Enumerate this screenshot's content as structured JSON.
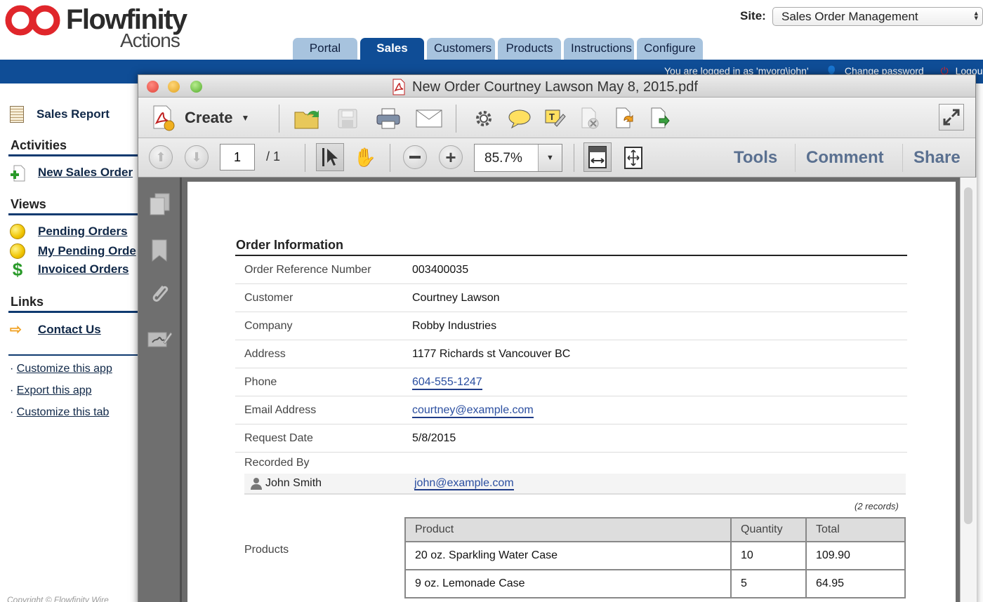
{
  "app": {
    "brand": "Flowfinity",
    "brand_sub": "Actions"
  },
  "site": {
    "label": "Site:",
    "value": "Sales Order Management"
  },
  "tabs": [
    {
      "label": "Portal",
      "active": false
    },
    {
      "label": "Sales",
      "active": true
    },
    {
      "label": "Customers",
      "active": false
    },
    {
      "label": "Products",
      "active": false
    },
    {
      "label": "Instructions",
      "active": false
    },
    {
      "label": "Configure",
      "active": false
    }
  ],
  "userbar": {
    "logged_in": "You are logged in as 'myorg\\john'",
    "change_password": "Change password",
    "logout": "Logou"
  },
  "sidebar": {
    "sales_report": "Sales Report",
    "activities_header": "Activities",
    "new_sales_order": "New Sales Order",
    "views_header": "Views",
    "pending_orders": "Pending Orders",
    "my_pending_orders": "My Pending Orde",
    "invoiced_orders": "Invoiced Orders",
    "links_header": "Links",
    "contact_us": "Contact Us",
    "customize_app": "Customize this app",
    "export_app": "Export this app",
    "customize_tab": "Customize this tab",
    "copyright": "Copyright © Flowfinity Wire"
  },
  "pdf": {
    "title": "New Order Courtney Lawson May 8, 2015.pdf",
    "create_label": "Create",
    "page_current": "1",
    "page_total": "/ 1",
    "zoom": "85.7%",
    "tools": "Tools",
    "comment": "Comment",
    "share": "Share"
  },
  "order": {
    "heading": "Order Information",
    "fields": [
      {
        "label": "Order Reference Number",
        "value": "003400035",
        "link": false
      },
      {
        "label": "Customer",
        "value": "Courtney Lawson",
        "link": false
      },
      {
        "label": "Company",
        "value": "Robby Industries",
        "link": false
      },
      {
        "label": "Address",
        "value": "1177 Richards st Vancouver BC",
        "link": false
      },
      {
        "label": "Phone",
        "value": "604-555-1247",
        "link": true
      },
      {
        "label": "Email Address",
        "value": "courtney@example.com",
        "link": true
      },
      {
        "label": "Request Date",
        "value": "5/8/2015",
        "link": false
      }
    ],
    "recorded_by_label": "Recorded By",
    "recorded_by_name": "John Smith",
    "recorded_by_email": "john@example.com",
    "records_count": "(2 records)",
    "products_label": "Products",
    "products_columns": [
      "Product",
      "Quantity",
      "Total"
    ],
    "products": [
      {
        "product": "20 oz. Sparkling Water Case",
        "quantity": "10",
        "total": "109.90"
      },
      {
        "product": "9 oz. Lemonade Case",
        "quantity": "5",
        "total": "64.95"
      }
    ]
  },
  "colors": {
    "brand_blue": "#0f4d96",
    "tab_light": "#a7c3de",
    "logo_red": "#e0262b",
    "link": "#2a4ea0"
  }
}
